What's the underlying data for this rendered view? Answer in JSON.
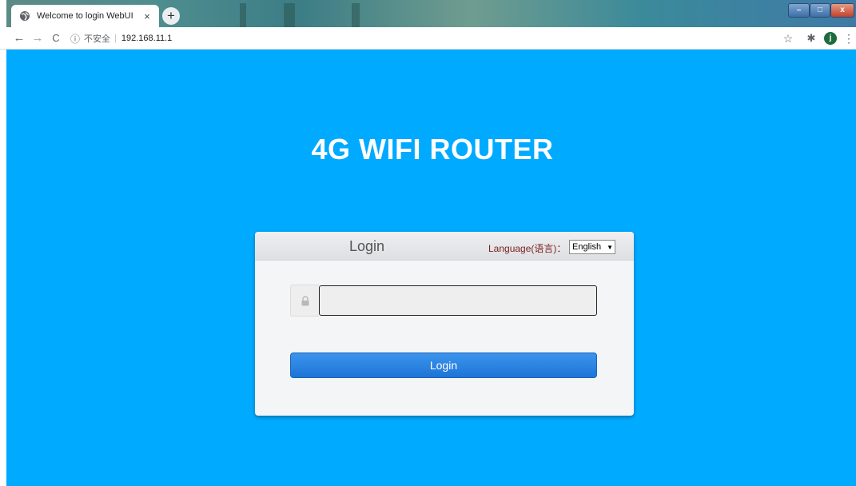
{
  "browser": {
    "tab": {
      "title": "Welcome to login WebUI",
      "close_glyph": "×",
      "icon": "globe-icon"
    },
    "new_tab_glyph": "+",
    "window_controls": {
      "minimize": "–",
      "maximize": "□",
      "close": "x"
    },
    "nav": {
      "back": "←",
      "forward": "→",
      "reload": "C"
    },
    "address": {
      "security_glyph": "ⓘ",
      "security_label": "不安全",
      "separator": "|",
      "url": "192.168.11.1"
    },
    "toolbar_icons": {
      "bookmark": "☆",
      "extensions": "✱",
      "menu": "⋮",
      "avatar_initial": "j"
    }
  },
  "page": {
    "background": "#00aaff",
    "title": "4G WIFI ROUTER",
    "login": {
      "header": "Login",
      "language_label": "Language(语言)：",
      "language_selected": "English",
      "password_value": "",
      "password_icon": "lock-icon",
      "button_label": "Login",
      "button_color": "#2a84e3"
    }
  }
}
